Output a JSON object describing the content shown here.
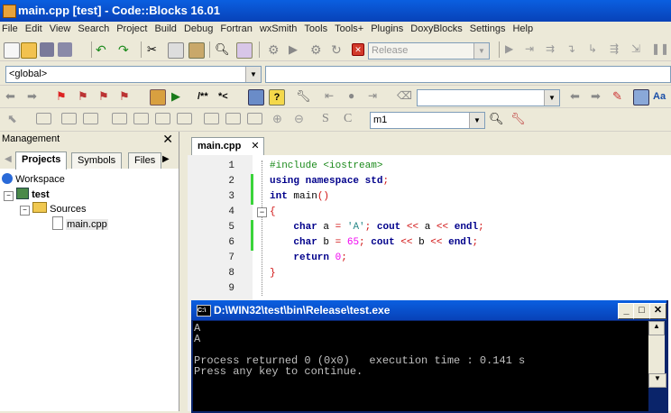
{
  "window": {
    "title": "main.cpp [test] - Code::Blocks 16.01"
  },
  "menu": [
    "File",
    "Edit",
    "View",
    "Search",
    "Project",
    "Build",
    "Debug",
    "Fortran",
    "wxSmith",
    "Tools",
    "Tools+",
    "Plugins",
    "DoxyBlocks",
    "Settings",
    "Help"
  ],
  "toolbar": {
    "build_target": "Release",
    "scope": "<global>",
    "doxy_comment": "/**",
    "doxy_line": "*<",
    "search_value": "m1",
    "icons": [
      "new-file-icon",
      "open-icon",
      "save-icon",
      "save-all-icon",
      "undo-icon",
      "redo-icon",
      "cut-icon",
      "copy-icon",
      "paste-icon",
      "find-icon",
      "replace-icon",
      "settings-icon",
      "run-icon",
      "build-run-icon",
      "rebuild-icon",
      "abort-icon"
    ]
  },
  "management": {
    "title": "Management",
    "close": "✕",
    "tabs": [
      "Projects",
      "Symbols",
      "Files"
    ],
    "tree": {
      "workspace": "Workspace",
      "project": "test",
      "folder": "Sources",
      "file": "main.cpp"
    }
  },
  "editor": {
    "tab_label": "main.cpp",
    "tab_close": "✕",
    "line_numbers": [
      "1",
      "2",
      "3",
      "4",
      "5",
      "6",
      "7",
      "8",
      "9"
    ],
    "lines": [
      {
        "html": "<span class=\"pp\">#include &lt;iostream&gt;</span>"
      },
      {
        "html": "<span class=\"kw\">using namespace</span> <span class=\"kw\">std</span><span class=\"op\">;</span>"
      },
      {
        "html": "<span class=\"kw\">int</span> main<span class=\"op\">()</span>"
      },
      {
        "html": "<span class=\"op\">{</span>"
      },
      {
        "html": "    <span class=\"kw\">char</span> a <span class=\"op\">=</span> <span class=\"str\">'A'</span><span class=\"op\">;</span> <span class=\"kw\">cout</span> <span class=\"op\">&lt;&lt;</span> a <span class=\"op\">&lt;&lt;</span> <span class=\"kw\">endl</span><span class=\"op\">;</span>"
      },
      {
        "html": "    <span class=\"kw\">char</span> b <span class=\"op\">=</span> <span class=\"num\">65</span><span class=\"op\">;</span> <span class=\"kw\">cout</span> <span class=\"op\">&lt;&lt;</span> b <span class=\"op\">&lt;&lt;</span> <span class=\"kw\">endl</span><span class=\"op\">;</span>"
      },
      {
        "html": "    <span class=\"kw\">return</span> <span class=\"num\">0</span><span class=\"op\">;</span>"
      },
      {
        "html": "<span class=\"op\">}</span>"
      },
      {
        "html": ""
      }
    ]
  },
  "console": {
    "title": "D:\\WIN32\\test\\bin\\Release\\test.exe",
    "output": "A\nA\n\nProcess returned 0 (0x0)   execution time : 0.141 s\nPress any key to continue."
  }
}
